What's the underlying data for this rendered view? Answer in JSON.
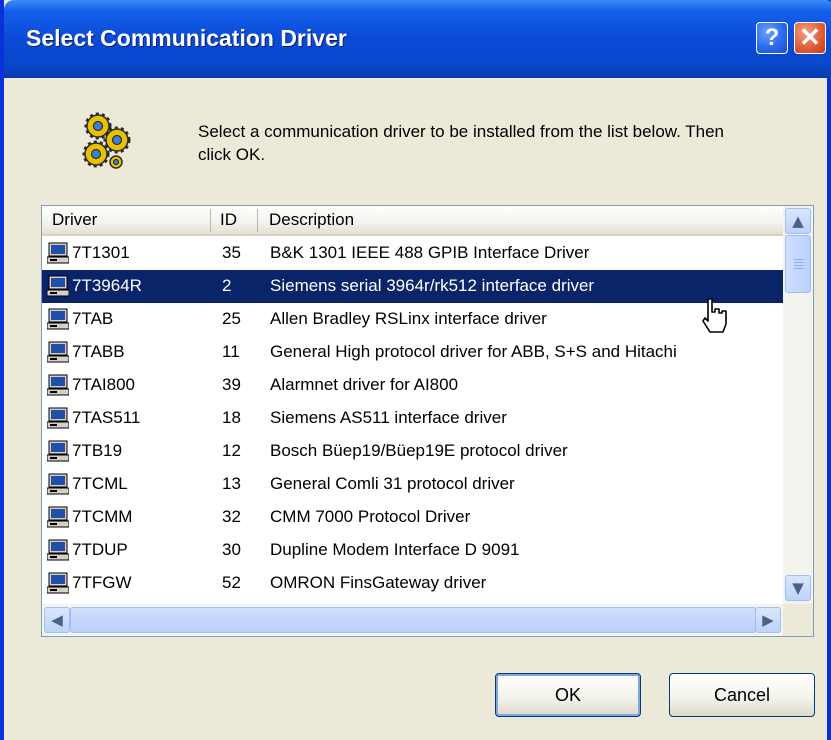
{
  "window": {
    "title": "Select Communication Driver",
    "help_label": "?",
    "close_label": "✕"
  },
  "instruction": "Select a communication driver to be installed from the list below. Then click OK.",
  "list": {
    "columns": [
      "Driver",
      "ID",
      "Description"
    ],
    "selected_index": 1,
    "rows": [
      {
        "driver": "7T1301",
        "id": "35",
        "description": "B&K 1301 IEEE 488 GPIB Interface Driver"
      },
      {
        "driver": "7T3964R",
        "id": "2",
        "description": "Siemens serial 3964r/rk512 interface driver"
      },
      {
        "driver": "7TAB",
        "id": "25",
        "description": "Allen Bradley RSLinx interface driver"
      },
      {
        "driver": "7TABB",
        "id": "11",
        "description": "General High protocol driver for ABB, S+S and Hitachi"
      },
      {
        "driver": "7TAI800",
        "id": "39",
        "description": "Alarmnet driver for AI800"
      },
      {
        "driver": "7TAS511",
        "id": "18",
        "description": "Siemens AS511 interface driver"
      },
      {
        "driver": "7TB19",
        "id": "12",
        "description": "Bosch Büep19/Büep19E protocol driver"
      },
      {
        "driver": "7TCML",
        "id": "13",
        "description": "General Comli 31 protocol driver"
      },
      {
        "driver": "7TCMM",
        "id": "32",
        "description": "CMM 7000 Protocol Driver"
      },
      {
        "driver": "7TDUP",
        "id": "30",
        "description": "Dupline Modem Interface D 9091"
      },
      {
        "driver": "7TFGW",
        "id": "52",
        "description": "OMRON FinsGateway driver"
      }
    ]
  },
  "buttons": {
    "ok": "OK",
    "cancel": "Cancel"
  },
  "icons": {
    "header": "gears-icon",
    "row": "computer-icon",
    "pointer": "hand-cursor-icon"
  },
  "colors": {
    "title_bar": "#0a4ad8",
    "selection": "#0a246a",
    "dialog_bg": "#ece9d8"
  }
}
